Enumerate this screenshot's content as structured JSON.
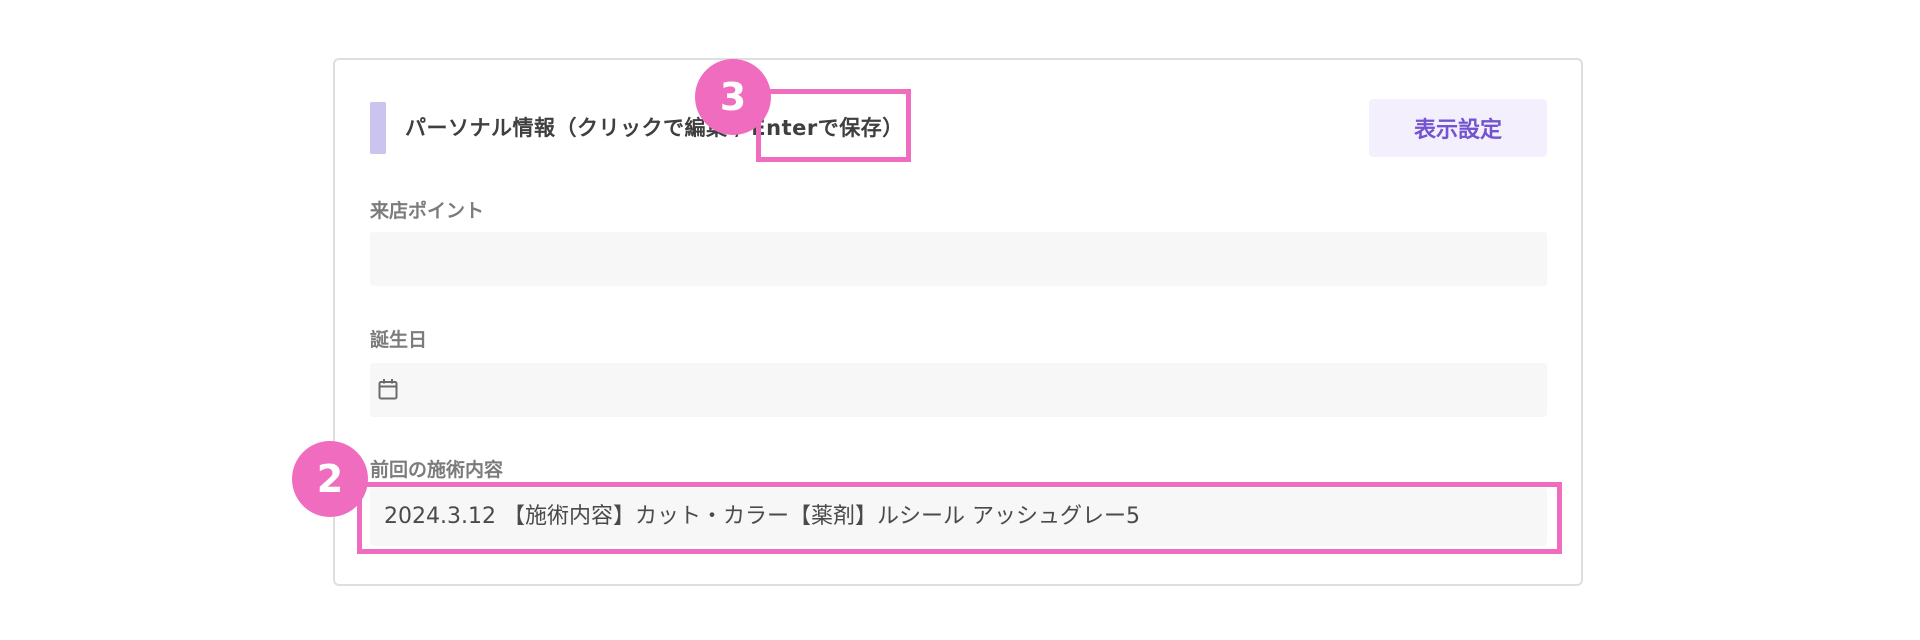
{
  "panel": {
    "title": "パーソナル情報（クリックで編集 / Enterで保存）",
    "display_settings_label": "表示設定"
  },
  "fields": {
    "visit_points": {
      "label": "来店ポイント",
      "value": ""
    },
    "birthday": {
      "label": "誕生日",
      "value": "",
      "icon": "calendar-icon"
    },
    "previous_treatment": {
      "label": "前回の施術内容",
      "value": "2024.3.12 【施術内容】カット・カラー【薬剤】ルシール アッシュグレー5"
    }
  },
  "annotations": {
    "step_2": "2",
    "step_3": "3"
  },
  "colors": {
    "annotation": "#f06cbf",
    "accent_bar": "#cbc3f0",
    "button_bg": "#f3effd",
    "button_text": "#7353cf",
    "input_bg": "#f7f7f7"
  }
}
